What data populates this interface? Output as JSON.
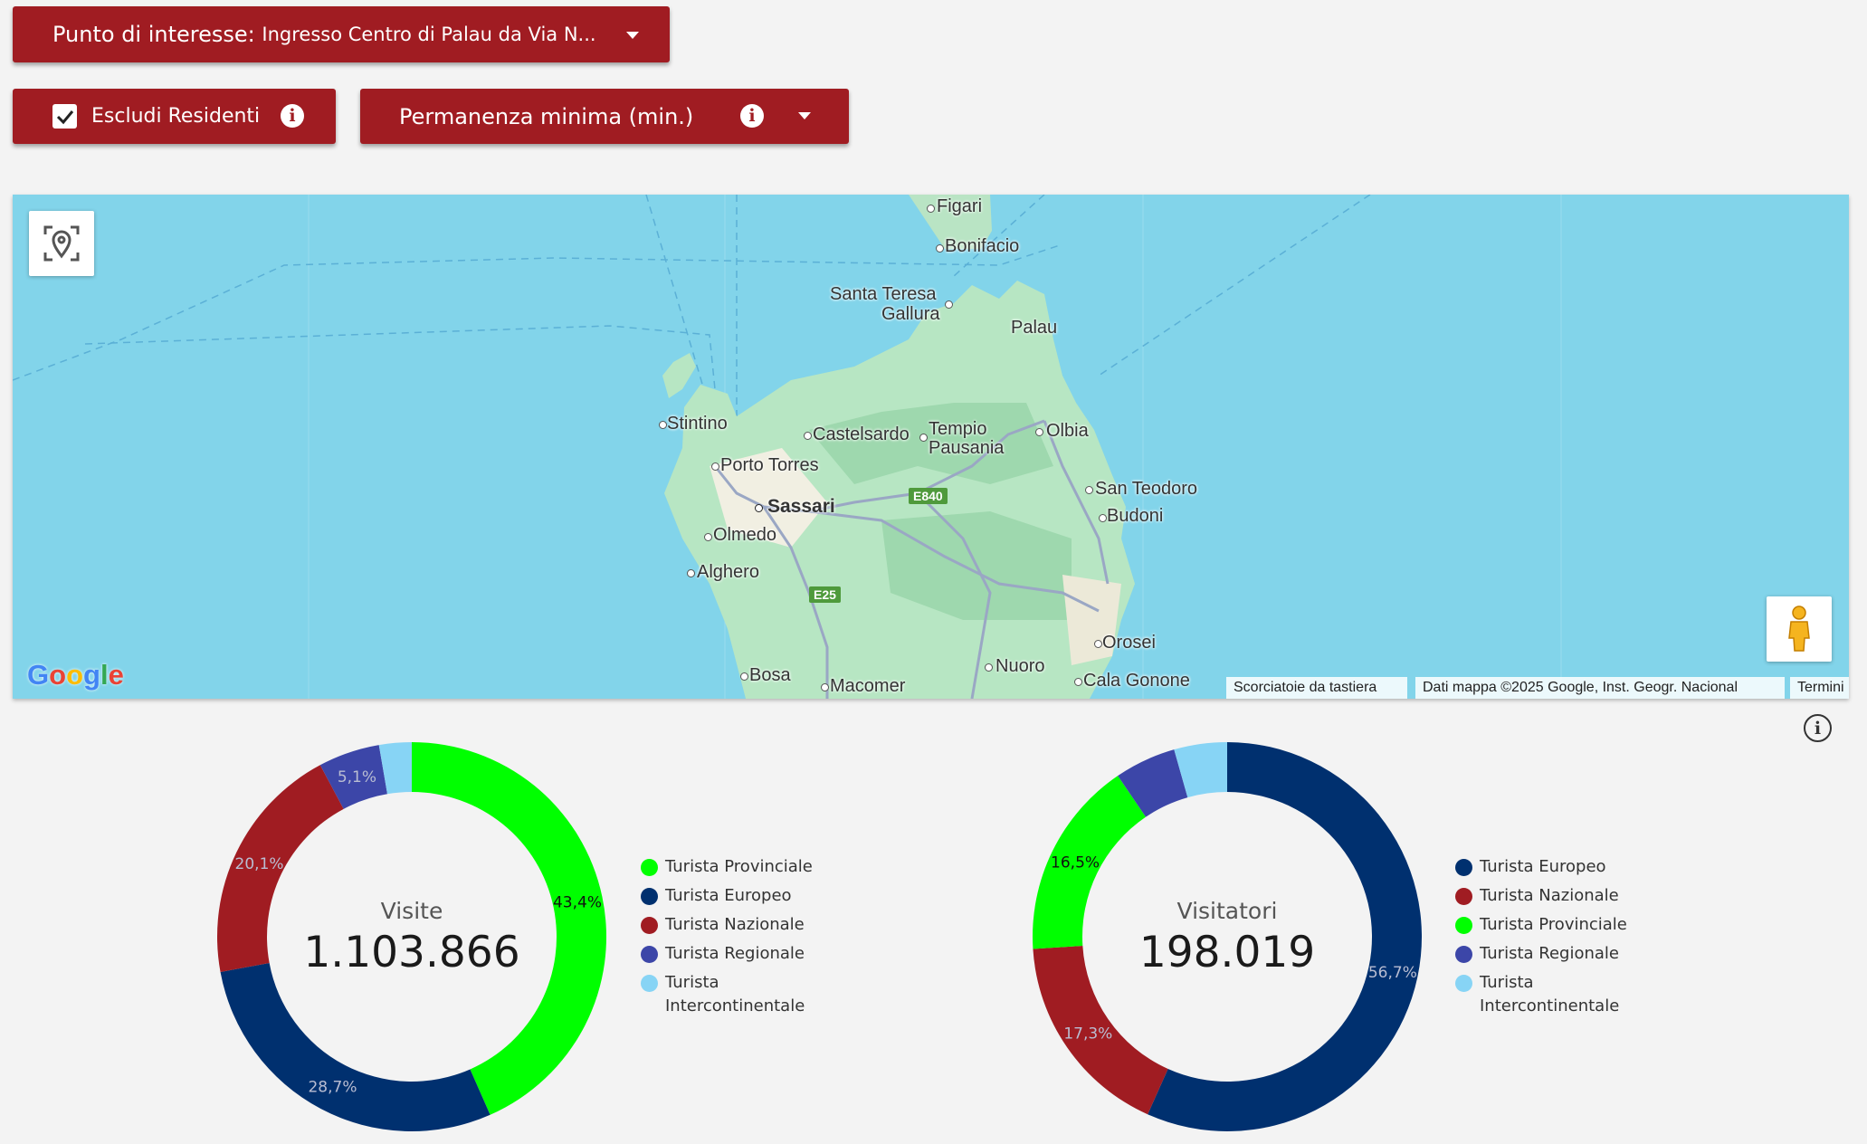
{
  "controls": {
    "poi_label": "Punto di interesse",
    "poi_value": "Ingresso Centro di Palau da Via N...",
    "exclude_residents_label": "Escludi Residenti",
    "exclude_residents_checked": true,
    "min_stay_label": "Permanenza minima (min.)"
  },
  "map": {
    "places": [
      "Figari",
      "Bonifacio",
      "Santa Teresa",
      "Gallura",
      "Palau",
      "Stintino",
      "Castelsardo",
      "Tempio",
      "Pausania",
      "Olbia",
      "Porto Torres",
      "San Teodoro",
      "Budoni",
      "Sassari",
      "Olmedo",
      "Alghero",
      "Orosei",
      "Nuoro",
      "Bosa",
      "Macomer",
      "Cala Gonone"
    ],
    "roads": [
      "E840",
      "E25"
    ],
    "logo": "Google",
    "attribution": {
      "shortcuts": "Scorciatoie da tastiera",
      "data": "Dati mappa ©2025 Google, Inst. Geogr. Nacional",
      "terms": "Termini"
    }
  },
  "charts": {
    "visits": {
      "title": "Visite",
      "total": "1.103.866",
      "legend": [
        "Turista Provinciale",
        "Turista Europeo",
        "Turista Nazionale",
        "Turista Regionale",
        "Turista Intercontinentale"
      ]
    },
    "visitors": {
      "title": "Visitatori",
      "total": "198.019",
      "legend": [
        "Turista Europeo",
        "Turista Nazionale",
        "Turista Provinciale",
        "Turista Regionale",
        "Turista Intercontinentale"
      ]
    }
  },
  "chart_data": [
    {
      "type": "pie",
      "title": "Visite",
      "categories": [
        "Turista Provinciale",
        "Turista Europeo",
        "Turista Nazionale",
        "Turista Regionale",
        "Turista Intercontinentale"
      ],
      "values": [
        43.4,
        28.7,
        20.1,
        5.1,
        2.7
      ],
      "labels": [
        "43,4%",
        "28,7%",
        "20,1%",
        "5,1%",
        ""
      ],
      "colors": [
        "#00ff00",
        "#00306f",
        "#a01c22",
        "#3c46a8",
        "#87d4f5"
      ]
    },
    {
      "type": "pie",
      "title": "Visitatori",
      "categories": [
        "Turista Europeo",
        "Turista Nazionale",
        "Turista Provinciale",
        "Turista Regionale",
        "Turista Intercontinentale"
      ],
      "values": [
        56.7,
        17.3,
        16.5,
        5.1,
        4.4
      ],
      "labels": [
        "56,7%",
        "17,3%",
        "16,5%",
        "",
        ""
      ],
      "colors": [
        "#00306f",
        "#a01c22",
        "#00ff00",
        "#3c46a8",
        "#87d4f5"
      ]
    }
  ]
}
